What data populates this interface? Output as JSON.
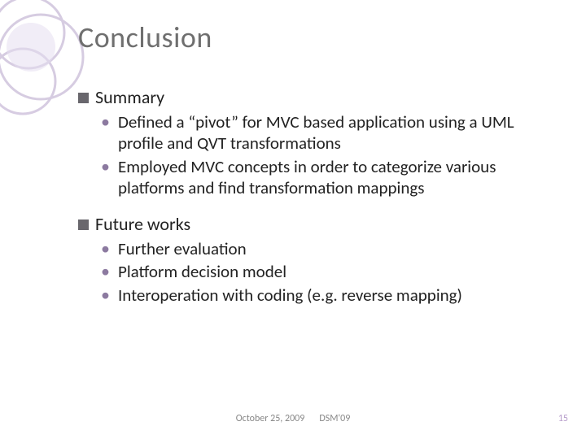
{
  "title": "Conclusion",
  "sections": [
    {
      "heading": "Summary",
      "items": [
        "Defined a “pivot” for MVC based application using a UML profile and QVT transformations",
        "Employed MVC concepts in order to categorize various platforms and find transformation mappings"
      ]
    },
    {
      "heading": "Future works",
      "items": [
        "Further evaluation",
        "Platform decision model",
        "Interoperation with coding (e.g. reverse mapping)"
      ]
    }
  ],
  "footer": {
    "date": "October 25, 2009",
    "venue": "DSM'09"
  },
  "page_number": "15",
  "deco_color": "#b8a6c9"
}
